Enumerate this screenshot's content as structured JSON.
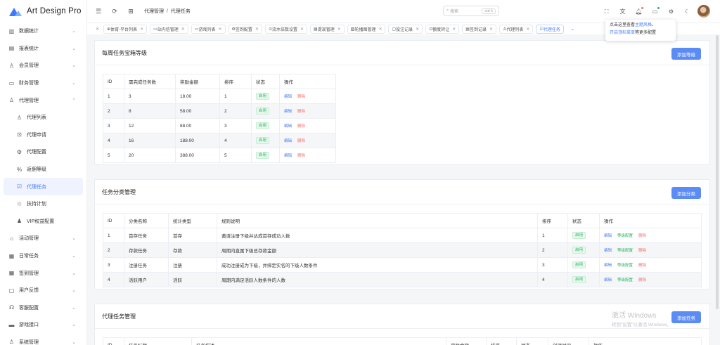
{
  "app": {
    "title": "Art Design Pro"
  },
  "sidebar": {
    "items": [
      {
        "label": "数据统计",
        "icon": "chart-icon",
        "glyph": "▥"
      },
      {
        "label": "报表统计",
        "icon": "report-icon",
        "glyph": "▤"
      },
      {
        "label": "会员管理",
        "icon": "user-icon",
        "glyph": "♙"
      },
      {
        "label": "财务管理",
        "icon": "wallet-icon",
        "glyph": "▭"
      },
      {
        "label": "代理管理",
        "icon": "agent-icon",
        "glyph": "♙",
        "expanded": true
      },
      {
        "label": "代理列表",
        "icon": "user-list-icon",
        "glyph": "♙",
        "sub": true
      },
      {
        "label": "代理申请",
        "icon": "apply-icon",
        "glyph": "⊡",
        "sub": true
      },
      {
        "label": "代理配置",
        "icon": "config-icon",
        "glyph": "⚙",
        "sub": true
      },
      {
        "label": "返佣等级",
        "icon": "percent-icon",
        "glyph": "%",
        "sub": true
      },
      {
        "label": "代理任务",
        "icon": "task-icon",
        "glyph": "☑",
        "sub": true,
        "active": true
      },
      {
        "label": "扶持计划",
        "icon": "support-icon",
        "glyph": "♲",
        "sub": true
      },
      {
        "label": "VIP权益配置",
        "icon": "vip-icon",
        "glyph": "♟",
        "sub": true
      },
      {
        "label": "活动管理",
        "icon": "gift-icon",
        "glyph": "⌂"
      },
      {
        "label": "日常任务",
        "icon": "calendar-icon",
        "glyph": "▦"
      },
      {
        "label": "签到管理",
        "icon": "checkin-icon",
        "glyph": "▦"
      },
      {
        "label": "用户反馈",
        "icon": "feedback-icon",
        "glyph": "▢"
      },
      {
        "label": "客服配置",
        "icon": "headset-icon",
        "glyph": "☊"
      },
      {
        "label": "游戏接口",
        "icon": "gamepad-icon",
        "glyph": "▬"
      },
      {
        "label": "系统管理",
        "icon": "system-icon",
        "glyph": "♙"
      }
    ]
  },
  "header": {
    "breadcrumb": [
      "代理管理",
      "代理任务"
    ],
    "search_placeholder": "搜索",
    "search_kbd": "ctrl k"
  },
  "tabs": [
    {
      "label": "体育-平台列表",
      "glyph": "⊕"
    },
    {
      "label": "站内信管理",
      "glyph": "▭"
    },
    {
      "label": "游戏列表",
      "glyph": "▭"
    },
    {
      "label": "签到配置",
      "glyph": "⚙"
    },
    {
      "label": "流水倍数设置",
      "glyph": "⊙"
    },
    {
      "label": "提现管理",
      "glyph": "▤"
    },
    {
      "label": "轮播图管理",
      "glyph": "▧"
    },
    {
      "label": "投注记录",
      "glyph": "▢"
    },
    {
      "label": "额度转让",
      "glyph": "⊙"
    },
    {
      "label": "签到记录",
      "glyph": "▤"
    },
    {
      "label": "代理列表",
      "glyph": "♙"
    },
    {
      "label": "代理任务",
      "glyph": "☑",
      "active": true
    }
  ],
  "tooltip": {
    "line1_a": "点击这里查看",
    "line1_b": "主题风格",
    "line1_c": "、",
    "line2_a": "开启顶栏菜单",
    "line2_b": "等更多配置"
  },
  "card1": {
    "title": "每周任务宝箱等级",
    "button": "添加等级",
    "headers": [
      "ID",
      "需完成任务数",
      "奖励金额",
      "排序",
      "状态",
      "操作"
    ],
    "rows": [
      [
        "1",
        "3",
        "18.00",
        "1"
      ],
      [
        "2",
        "8",
        "58.00",
        "2"
      ],
      [
        "3",
        "12",
        "88.00",
        "3"
      ],
      [
        "4",
        "16",
        "188.00",
        "4"
      ],
      [
        "5",
        "20",
        "388.00",
        "5"
      ]
    ],
    "status": "启用",
    "edit": "编辑",
    "delete": "删除"
  },
  "card2": {
    "title": "任务分类管理",
    "button": "添加分类",
    "headers": [
      "ID",
      "分类名称",
      "统计类型",
      "规则说明",
      "排序",
      "状态",
      "操作"
    ],
    "rows": [
      [
        "1",
        "首存任务",
        "首存",
        "邀请注册下级并达成首存成功人数",
        "1"
      ],
      [
        "2",
        "存款任务",
        "存款",
        "周期内直属下级总存款金额",
        "2"
      ],
      [
        "3",
        "注册任务",
        "注册",
        "成功注册成为下级，并绑定实名的下级人数条件",
        "3"
      ],
      [
        "4",
        "活跃用户",
        "活跃",
        "周期内满足活跃人数条件的人数",
        "4"
      ]
    ],
    "status": "启用",
    "edit": "编辑",
    "config": "等级配置",
    "delete": "删除"
  },
  "card3": {
    "title": "代理任务管理",
    "button": "添加任务",
    "headers": [
      "ID",
      "任务标题",
      "任务描述",
      "奖励金额",
      "排序",
      "状态",
      "创建时间",
      "操作"
    ]
  },
  "watermark": {
    "line1": "激活 Windows",
    "line2": "转到\"设置\"以激活 Windows。"
  }
}
